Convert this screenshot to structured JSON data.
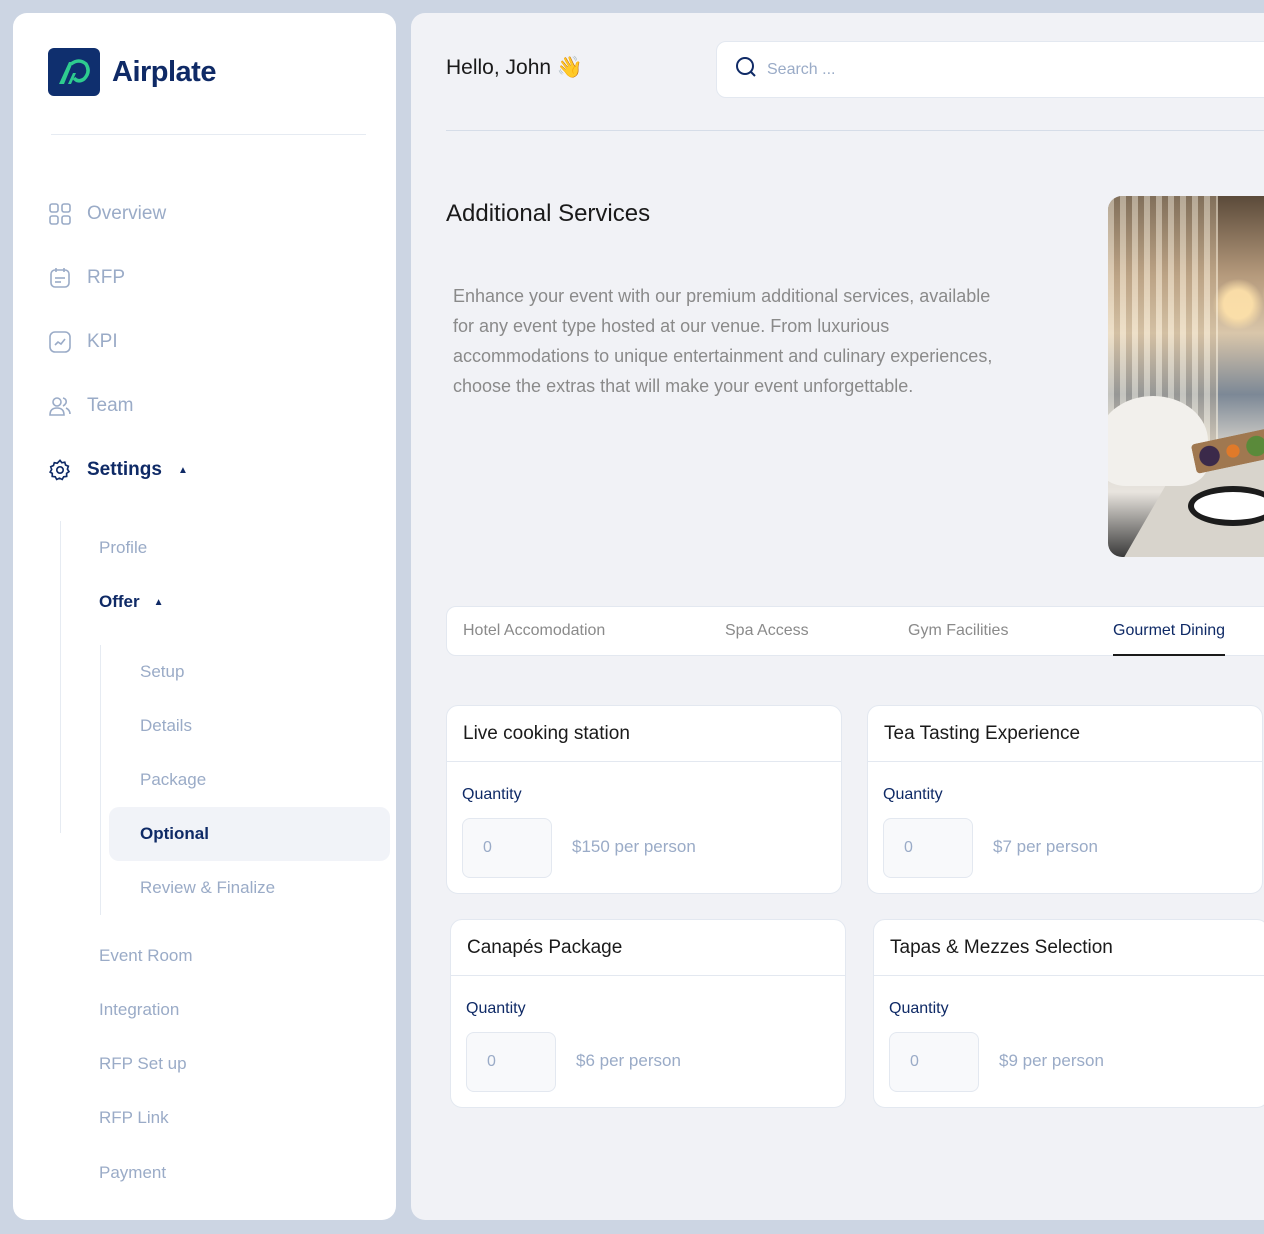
{
  "app": {
    "name": "Airplate",
    "brand_color": "#0f2a66",
    "logo_accent": "#2ecc8f"
  },
  "sidebar": {
    "nav": [
      {
        "label": "Overview",
        "icon": "grid-icon"
      },
      {
        "label": "RFP",
        "icon": "calendar-note-icon"
      },
      {
        "label": "KPI",
        "icon": "trend-chart-icon"
      },
      {
        "label": "Team",
        "icon": "users-icon"
      },
      {
        "label": "Settings",
        "icon": "gear-icon",
        "expanded": true,
        "active": true
      }
    ],
    "settings_children": [
      {
        "label": "Profile"
      },
      {
        "label": "Offer",
        "expanded": true,
        "active": true
      },
      {
        "label": "Event Room"
      },
      {
        "label": "Integration"
      },
      {
        "label": "RFP Set up"
      },
      {
        "label": "RFP Link"
      },
      {
        "label": "Payment"
      }
    ],
    "offer_children": [
      {
        "label": "Setup"
      },
      {
        "label": "Details"
      },
      {
        "label": "Package"
      },
      {
        "label": "Optional",
        "active": true
      },
      {
        "label": "Review &  Finalize"
      }
    ]
  },
  "header": {
    "greeting": "Hello, John 👋",
    "search_placeholder": "Search ..."
  },
  "main": {
    "title": "Additional Services",
    "description": "Enhance your event with our premium additional services, available for any event type hosted at our venue. From luxurious accommodations to unique entertainment and culinary experiences, choose the extras that will make your event unforgettable.",
    "image_alt": "Gourmet dining room with food platter"
  },
  "tabs": [
    {
      "label": "Hotel Accomodation",
      "active": false
    },
    {
      "label": "Spa Access",
      "active": false
    },
    {
      "label": "Gym Facilities",
      "active": false
    },
    {
      "label": "Gourmet Dining",
      "active": true
    }
  ],
  "services": [
    {
      "title": "Live cooking station",
      "quantity_label": "Quantity",
      "quantity_value": "0",
      "price": "$150 per person"
    },
    {
      "title": "Tea Tasting Experience",
      "quantity_label": "Quantity",
      "quantity_value": "0",
      "price": "$7 per person"
    },
    {
      "title": "Canapés Package",
      "quantity_label": "Quantity",
      "quantity_value": "0",
      "price": "$6 per person"
    },
    {
      "title": "Tapas & Mezzes Selection",
      "quantity_label": "Quantity",
      "quantity_value": "0",
      "price": "$9 per person"
    }
  ]
}
